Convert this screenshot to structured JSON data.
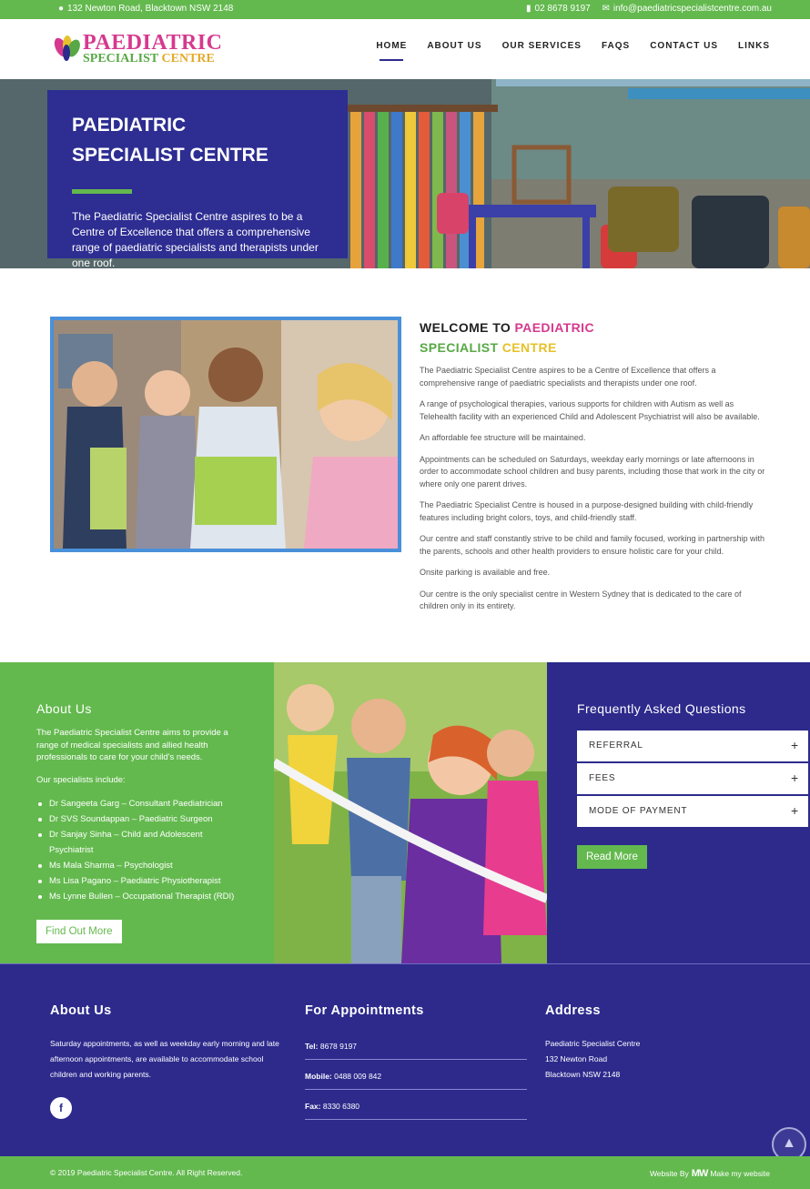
{
  "topbar": {
    "address": "132 Newton Road, Blacktown NSW 2148",
    "phone": "02 8678 9197",
    "email": "info@paediatricspecialistcentre.com.au"
  },
  "header": {
    "logo_line1": "PAEDIATRIC",
    "logo_line2": "SPECIALIST",
    "logo_line2b": "CENTRE",
    "nav": [
      "HOME",
      "ABOUT US",
      "OUR SERVICES",
      "FAQS",
      "CONTACT US",
      "LINKS"
    ]
  },
  "hero": {
    "title_line1": "PAEDIATRIC",
    "title_line2": "SPECIALIST CENTRE",
    "text": "The Paediatric Specialist Centre aspires to be a Centre of Excellence that offers a comprehensive range of paediatric specialists and therapists under one roof."
  },
  "welcome": {
    "heading_a": "WELCOME TO ",
    "heading_b": "PAEDIATRIC",
    "heading_c": "SPECIALIST ",
    "heading_d": "CENTRE",
    "paragraphs": [
      "The Paediatric Specialist Centre aspires to be a Centre of Excellence that offers a comprehensive range of paediatric specialists and therapists under one roof.",
      "A range of psychological therapies, various supports for children with Autism as well as Telehealth facility with an experienced Child and Adolescent Psychiatrist will also be available.",
      "An affordable fee structure will be maintained.",
      "Appointments can be scheduled on Saturdays, weekday early mornings or late afternoons in order to accommodate school children and busy parents, including those that work in the city or where only one parent drives.",
      "The Paediatric Specialist Centre is housed in a purpose-designed building with child-friendly features including bright colors, toys, and child-friendly staff.",
      "Our centre and staff constantly strive to be child and family focused, working in partnership with the parents, schools and other health providers to ensure holistic care for your child.",
      "Onsite parking is available and free.",
      "Our centre is the only specialist centre in Western Sydney that is dedicated to the care of children only in its entirety."
    ]
  },
  "about": {
    "title": "About Us",
    "intro": "The Paediatric Specialist Centre aims to provide a range of medical specialists and allied health professionals to care for your child's needs.",
    "specialists_label": "Our specialists include:",
    "specialists": [
      "Dr Sangeeta Garg – Consultant Paediatrician",
      "Dr SVS Soundappan – Paediatric Surgeon",
      "Dr Sanjay Sinha – Child and Adolescent Psychiatrist",
      "Ms Mala Sharma – Psychologist",
      "Ms Lisa Pagano – Paediatric Physiotherapist",
      "Ms Lynne Bullen – Occupational Therapist (RDI)"
    ],
    "button": "Find Out More"
  },
  "faq": {
    "title": "Frequently Asked Questions",
    "items": [
      "REFERRAL",
      "FEES",
      "MODE OF PAYMENT"
    ],
    "button": "Read More"
  },
  "footer": {
    "about_title": "About Us",
    "about_text": "Saturday appointments, as well as weekday early morning and late afternoon appointments, are available to accommodate school children and working parents.",
    "appt_title": "For Appointments",
    "tel_label": "Tel:",
    "tel": "8678 9197",
    "mobile_label": "Mobile:",
    "mobile": "0488 009 842",
    "fax_label": "Fax:",
    "fax": "8330 6380",
    "address_title": "Address",
    "address_lines": [
      "Paediatric Specialist Centre",
      "132 Newton Road",
      "Blacktown NSW 2148"
    ],
    "facebook": "f"
  },
  "bottombar": {
    "copyright": "© 2019 Paediatric Specialist Centre. All Right Reserved.",
    "by_label": "Website By",
    "by_logo": "MW",
    "by_name": "Make my website"
  },
  "colors": {
    "green": "#63b94e",
    "navy": "#2d2a8c",
    "pink": "#d6398e",
    "yellow": "#e6c12a"
  },
  "icons": [
    "map-pin-icon",
    "phone-icon",
    "mail-icon",
    "facebook-icon",
    "plus-icon",
    "arrow-up-icon"
  ]
}
